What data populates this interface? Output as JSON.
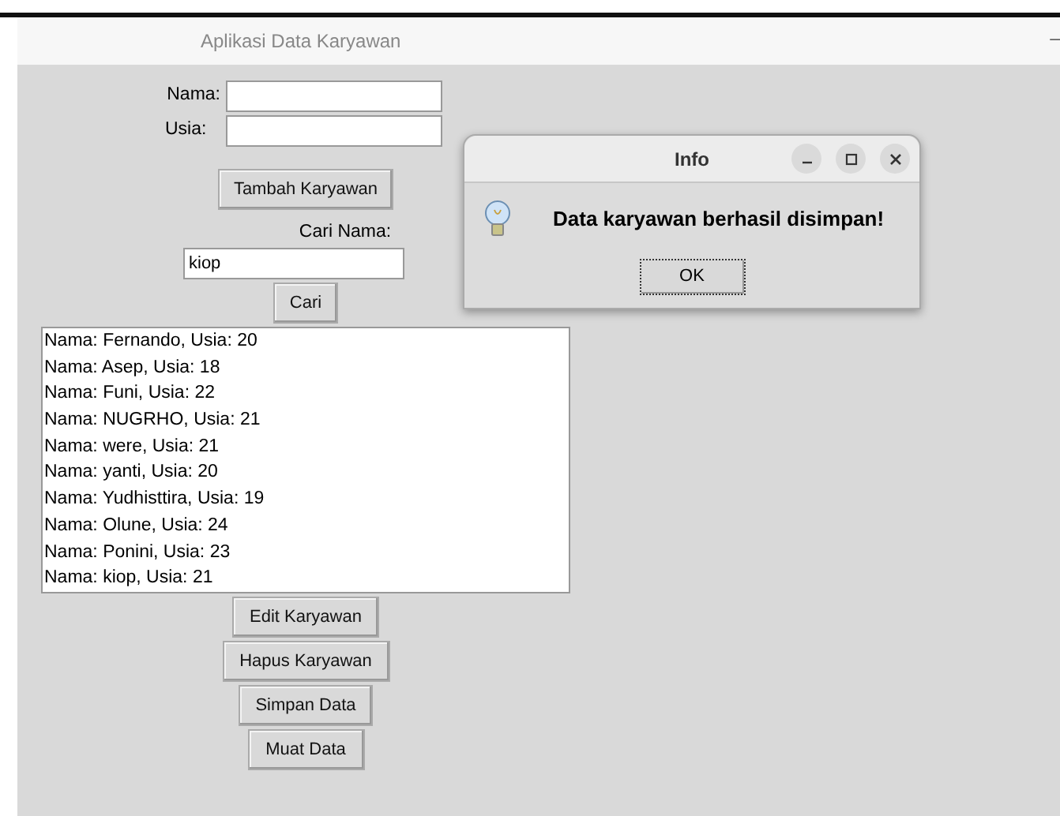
{
  "window": {
    "title": "Aplikasi Data Karyawan",
    "minimize_glyph": "–"
  },
  "form": {
    "fields": [
      {
        "label": "Nama:"
      },
      {
        "label": "Usia:"
      }
    ],
    "add_button": "Tambah Karyawan",
    "search_label": "Cari Nama:",
    "search_value": "kiop",
    "search_button": "Cari"
  },
  "list": [
    {
      "text": "Nama: Fernando, Usia: 20"
    },
    {
      "text": "Nama: Asep, Usia: 18"
    },
    {
      "text": "Nama: Funi, Usia: 22"
    },
    {
      "text": "Nama: NUGRHO, Usia: 21"
    },
    {
      "text": "Nama: were, Usia: 21"
    },
    {
      "text": "Nama: yanti, Usia: 20"
    },
    {
      "text": "Nama: Yudhisttira, Usia: 19"
    },
    {
      "text": "Nama: Olune, Usia: 24"
    },
    {
      "text": "Nama: Ponini, Usia: 23"
    },
    {
      "text": "Nama: kiop, Usia: 21"
    }
  ],
  "buttons": [
    "Edit Karyawan",
    "Hapus Karyawan",
    "Simpan Data",
    "Muat Data"
  ],
  "dialog": {
    "title": "Info",
    "message": "Data karyawan berhasil disimpan!",
    "ok_button": "OK"
  }
}
